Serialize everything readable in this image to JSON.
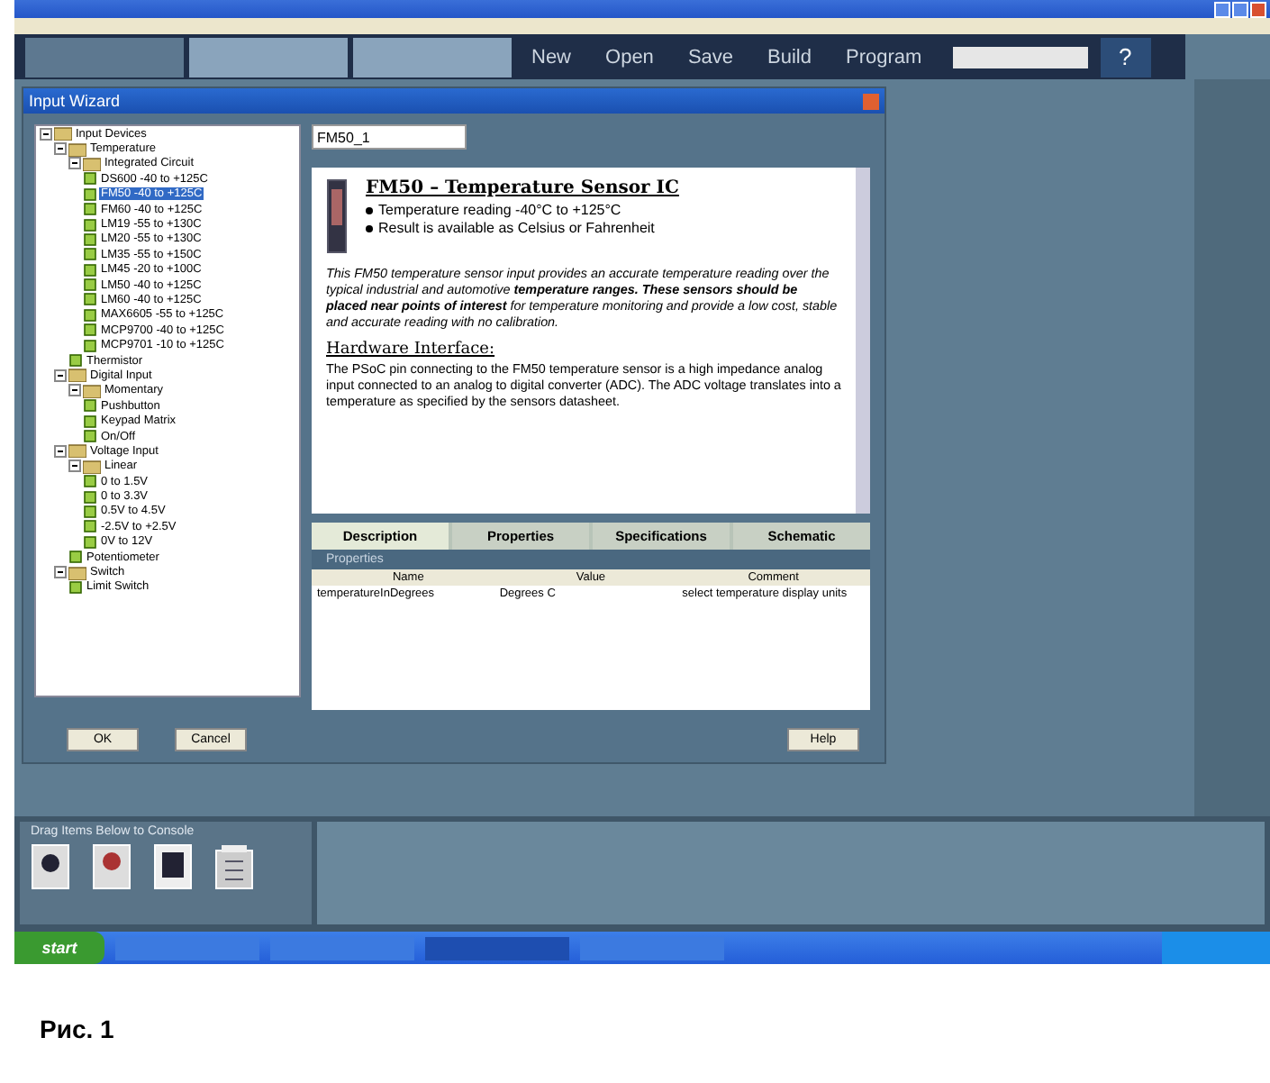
{
  "toolbar": {
    "mode_tabs": [
      {
        "selected": false
      },
      {
        "selected": true
      },
      {
        "selected": true
      }
    ],
    "buttons": [
      "New",
      "Open",
      "Save",
      "Build",
      "Program"
    ],
    "help": "?"
  },
  "dialog": {
    "title": "Input Wizard",
    "tree": [
      {
        "label": "Input Devices",
        "selected": false,
        "expanded": true,
        "children": [
          {
            "label": "Temperature",
            "selected": false,
            "expanded": true,
            "children": [
              {
                "label": "Integrated Circuit",
                "selected": false,
                "expanded": true,
                "children": [
                  {
                    "label": "DS600 -40 to +125C",
                    "selected": false
                  },
                  {
                    "label": "FM50 -40 to +125C",
                    "selected": true
                  },
                  {
                    "label": "FM60 -40 to +125C",
                    "selected": false
                  },
                  {
                    "label": "LM19 -55 to +130C",
                    "selected": false
                  },
                  {
                    "label": "LM20 -55 to +130C",
                    "selected": false
                  },
                  {
                    "label": "LM35 -55 to +150C",
                    "selected": false
                  },
                  {
                    "label": "LM45 -20 to +100C",
                    "selected": false
                  },
                  {
                    "label": "LM50 -40 to +125C",
                    "selected": false
                  },
                  {
                    "label": "LM60 -40 to +125C",
                    "selected": false
                  },
                  {
                    "label": "MAX6605 -55 to +125C",
                    "selected": false
                  },
                  {
                    "label": "MCP9700 -40 to +125C",
                    "selected": false
                  },
                  {
                    "label": "MCP9701 -10 to +125C",
                    "selected": false
                  }
                ]
              },
              {
                "label": "Thermistor",
                "selected": false
              }
            ]
          },
          {
            "label": "Digital Input",
            "selected": false,
            "expanded": true,
            "children": [
              {
                "label": "Momentary",
                "selected": false,
                "expanded": true,
                "children": [
                  {
                    "label": "Pushbutton",
                    "selected": false
                  },
                  {
                    "label": "Keypad Matrix",
                    "selected": false
                  },
                  {
                    "label": "On/Off",
                    "selected": false
                  }
                ]
              }
            ]
          },
          {
            "label": "Voltage Input",
            "selected": false,
            "expanded": true,
            "children": [
              {
                "label": "Linear",
                "selected": false,
                "expanded": true,
                "children": [
                  {
                    "label": "0 to 1.5V",
                    "selected": false
                  },
                  {
                    "label": "0 to 3.3V",
                    "selected": false
                  },
                  {
                    "label": "0.5V to 4.5V",
                    "selected": false
                  },
                  {
                    "label": "-2.5V to +2.5V",
                    "selected": false
                  },
                  {
                    "label": "0V to 12V",
                    "selected": false
                  }
                ]
              },
              {
                "label": "Potentiometer",
                "selected": false
              }
            ]
          },
          {
            "label": "Switch",
            "selected": false,
            "expanded": true,
            "children": [
              {
                "label": "Limit Switch",
                "selected": false
              }
            ]
          }
        ]
      }
    ],
    "name_field": "FM50_1",
    "doc": {
      "heading": "FM50 – Temperature Sensor IC",
      "bullets": [
        "Temperature reading -40°C to +125°C",
        "Result is available as Celsius or Fahrenheit"
      ],
      "intro": "This FM50 temperature sensor input provides an accurate temperature reading over the typical industrial and automotive **temperature ranges. These sensors should be placed near points of interest** for temperature monitoring and provide a low cost, stable and accurate reading with no calibration.",
      "subheading": "Hardware Interface:",
      "body": "The PSoC pin connecting to the FM50 temperature sensor is a high impedance analog input connected to an analog to digital converter (ADC). The ADC voltage translates into a temperature as specified by the sensors datasheet."
    },
    "tabs": [
      {
        "label": "Description",
        "selected": true
      },
      {
        "label": "Properties",
        "selected": false
      },
      {
        "label": "Specifications",
        "selected": false
      },
      {
        "label": "Schematic",
        "selected": false
      }
    ],
    "grid_title": "Properties",
    "table": {
      "columns": [
        "Name",
        "Value",
        "Comment"
      ],
      "rows": [
        [
          "temperatureInDegrees",
          "Degrees C",
          "select temperature display units"
        ]
      ]
    },
    "buttons": [
      "OK",
      "Cancel",
      "Help"
    ]
  },
  "tray": {
    "title": "Drag Items Below to Console"
  },
  "taskbar": {
    "start": "start"
  },
  "caption": "Рис. 1"
}
